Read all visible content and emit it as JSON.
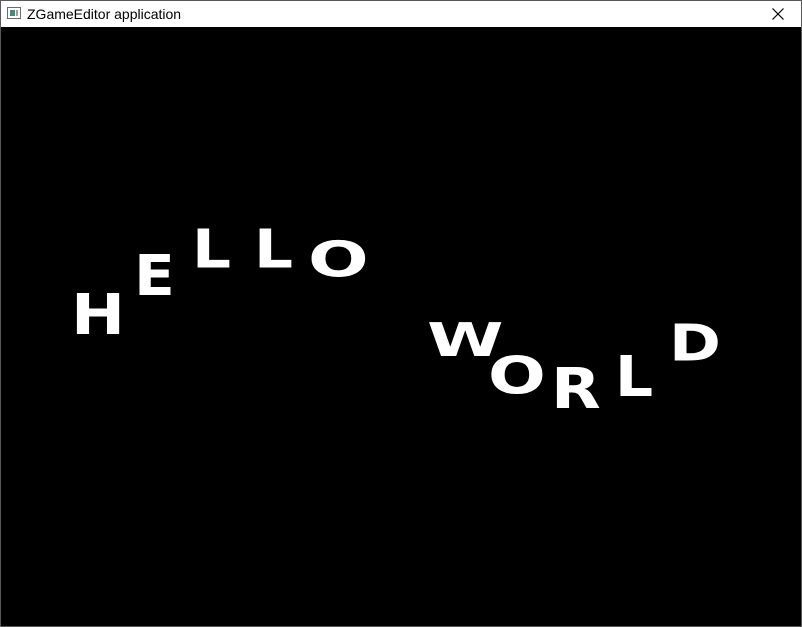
{
  "window": {
    "title": "ZGameEditor application",
    "close_icon": "close-icon",
    "app_icon": "app-window-icon"
  },
  "scene": {
    "background_color": "#000000",
    "text_color": "#ffffff",
    "hello_letters": [
      "H",
      "E",
      "L",
      "L",
      "O"
    ],
    "world_letters": [
      "W",
      "O",
      "R",
      "L",
      "D"
    ]
  }
}
